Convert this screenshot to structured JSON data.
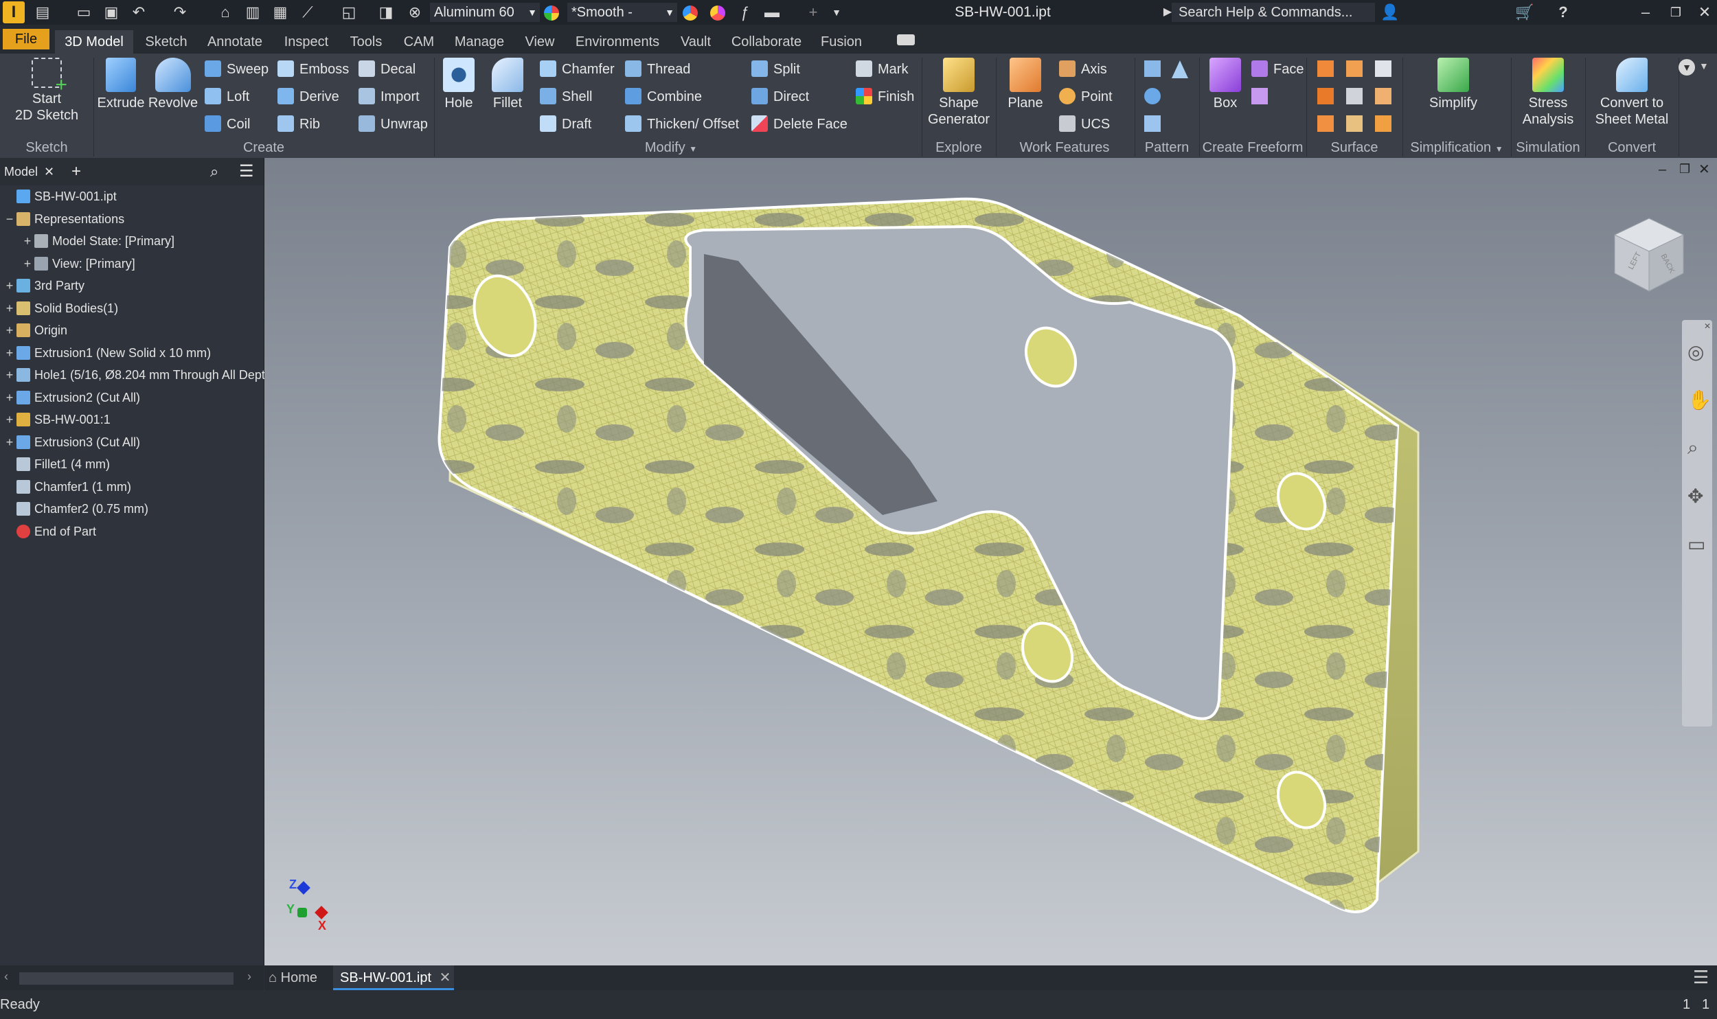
{
  "titlebar": {
    "app_logo": "I",
    "material": "Aluminum 60",
    "appearance": "*Smooth -",
    "document_title": "SB-HW-001.ipt",
    "search_placeholder": "Search Help & Commands..."
  },
  "tabs": [
    "File",
    "3D Model",
    "Sketch",
    "Annotate",
    "Inspect",
    "Tools",
    "CAM",
    "Manage",
    "View",
    "Environments",
    "Vault",
    "Collaborate",
    "Fusion"
  ],
  "ribbon": {
    "sketch": {
      "start_sketch": "Start\n2D Sketch",
      "group": "Sketch"
    },
    "create": {
      "extrude": "Extrude",
      "revolve": "Revolve",
      "sweep": "Sweep",
      "loft": "Loft",
      "coil": "Coil",
      "emboss": "Emboss",
      "derive": "Derive",
      "rib": "Rib",
      "decal": "Decal",
      "import": "Import",
      "unwrap": "Unwrap",
      "group": "Create"
    },
    "modify": {
      "hole": "Hole",
      "fillet": "Fillet",
      "chamfer": "Chamfer",
      "shell": "Shell",
      "draft": "Draft",
      "thread": "Thread",
      "combine": "Combine",
      "thicken": "Thicken/ Offset",
      "split": "Split",
      "direct": "Direct",
      "delete_face": "Delete Face",
      "mark": "Mark",
      "finish": "Finish",
      "group": "Modify"
    },
    "explore": {
      "shape_generator": "Shape\nGenerator",
      "group": "Explore"
    },
    "work_features": {
      "plane": "Plane",
      "axis": "Axis",
      "point": "Point",
      "ucs": "UCS",
      "group": "Work Features"
    },
    "pattern": {
      "group": "Pattern"
    },
    "freeform": {
      "box": "Box",
      "face": "Face",
      "group": "Create Freeform"
    },
    "surface": {
      "group": "Surface"
    },
    "simplification": {
      "simplify": "Simplify",
      "group": "Simplification"
    },
    "simulation": {
      "stress": "Stress\nAnalysis",
      "group": "Simulation"
    },
    "convert": {
      "sheet_metal": "Convert to\nSheet Metal",
      "group": "Convert"
    }
  },
  "browser": {
    "tab_label": "Model",
    "items": [
      {
        "label": "SB-HW-001.ipt",
        "indent": 0,
        "exp": ""
      },
      {
        "label": "Representations",
        "indent": 0,
        "exp": "−"
      },
      {
        "label": "Model State: [Primary]",
        "indent": 1,
        "exp": "+"
      },
      {
        "label": "View: [Primary]",
        "indent": 1,
        "exp": "+"
      },
      {
        "label": "3rd Party",
        "indent": 0,
        "exp": "+"
      },
      {
        "label": "Solid Bodies(1)",
        "indent": 0,
        "exp": "+"
      },
      {
        "label": "Origin",
        "indent": 0,
        "exp": "+"
      },
      {
        "label": "Extrusion1 (New Solid x 10 mm)",
        "indent": 0,
        "exp": "+"
      },
      {
        "label": "Hole1 (5/16, Ø8.204 mm Through All Dept",
        "indent": 0,
        "exp": "+"
      },
      {
        "label": "Extrusion2 (Cut All)",
        "indent": 0,
        "exp": "+"
      },
      {
        "label": "SB-HW-001:1",
        "indent": 0,
        "exp": "+"
      },
      {
        "label": "Extrusion3 (Cut All)",
        "indent": 0,
        "exp": "+"
      },
      {
        "label": "Fillet1 (4 mm)",
        "indent": 0,
        "exp": ""
      },
      {
        "label": "Chamfer1 (1 mm)",
        "indent": 0,
        "exp": ""
      },
      {
        "label": "Chamfer2 (0.75 mm)",
        "indent": 0,
        "exp": ""
      },
      {
        "label": "End of Part",
        "indent": 0,
        "exp": ""
      }
    ]
  },
  "viewcube": {
    "face_top": "LEFT",
    "face_side": "BACK"
  },
  "triad": {
    "z": "Z",
    "y": "Y",
    "x": "X"
  },
  "doc_tabs": {
    "home": "Home",
    "active": "SB-HW-001.ipt"
  },
  "status": {
    "text": "Ready",
    "page_a": "1",
    "page_b": "1"
  }
}
